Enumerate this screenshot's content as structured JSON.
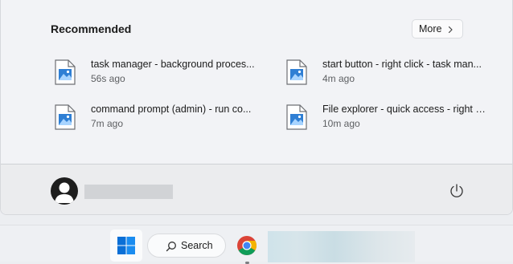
{
  "recommended": {
    "title": "Recommended",
    "more_label": "More",
    "items": [
      {
        "name": "task manager - background proces...",
        "time": "56s ago"
      },
      {
        "name": "start button - right click - task man...",
        "time": "4m ago"
      },
      {
        "name": "command prompt (admin) - run co...",
        "time": "7m ago"
      },
      {
        "name": "File explorer - quick access - right c...",
        "time": "10m ago"
      }
    ]
  },
  "taskbar": {
    "search_label": "Search"
  },
  "colors": {
    "windows_blue": "#0a6fd6",
    "file_icon_accent": "#2f7fd4"
  }
}
